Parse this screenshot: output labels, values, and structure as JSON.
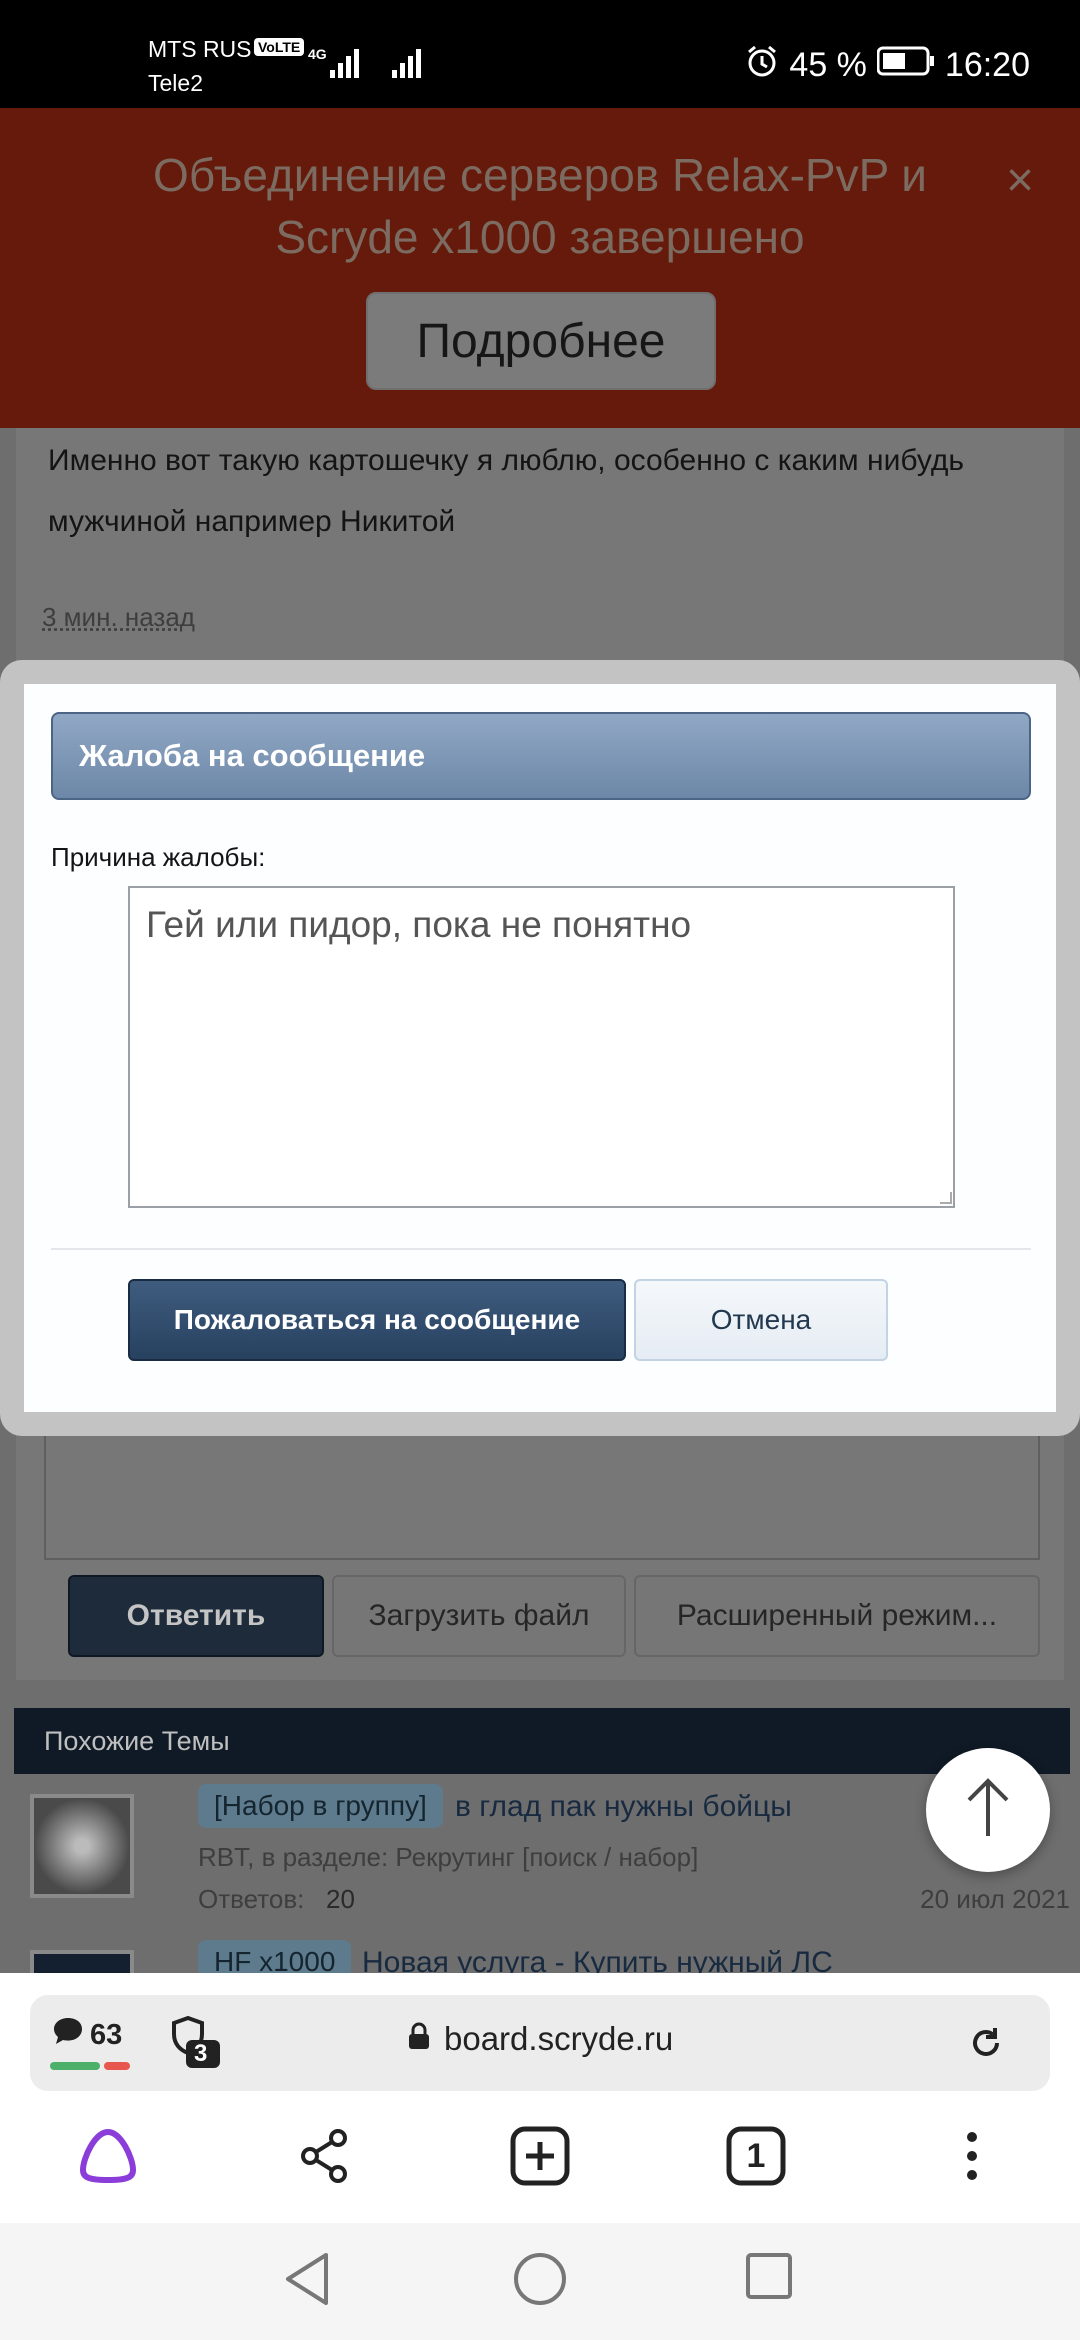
{
  "status_bar": {
    "carrier1": "MTS RUS",
    "volte": "VoLTE",
    "network": "4G",
    "carrier2": "Tele2",
    "battery": "45 %",
    "time": "16:20"
  },
  "banner": {
    "text": "Объединение серверов Relax-PvP и Scryde x1000 завершено",
    "close": "×",
    "button": "Подробнее"
  },
  "post": {
    "text": "Именно вот такую картошечку я люблю, особенно с каким нибудь мужчиной например Никитой",
    "time": "3 мин. назад"
  },
  "reply_toolbar": {
    "reply": "Ответить",
    "upload": "Загрузить файл",
    "advanced": "Расширенный режим..."
  },
  "similar": {
    "header": "Похожие Темы",
    "threads": [
      {
        "tag": "[Набор в группу]",
        "title": "в глад пак нужны бойцы",
        "meta": "RBT, в разделе: Рекрутинг [поиск / набор]",
        "replies_label": "Ответов:",
        "replies": "20",
        "date": "20 июл 2021"
      },
      {
        "tag": "HF x1000",
        "title": "Новая услуга - Купить нужный ЛС"
      }
    ]
  },
  "modal": {
    "title": "Жалоба на сообщение",
    "reason_label": "Причина жалобы:",
    "reason_value": "Гей или пидор, пока не понятно",
    "submit": "Пожаловаться на сообщение",
    "cancel": "Отмена"
  },
  "browser": {
    "comments_count": "63",
    "shield_count": "3",
    "url": "board.scryde.ru",
    "tabs_count": "1"
  },
  "colors": {
    "banner_bg": "#661a0b",
    "modal_header": "#7d96b6",
    "submit_btn": "#2f4b6c",
    "alice_purple": "#8b3dd9"
  }
}
